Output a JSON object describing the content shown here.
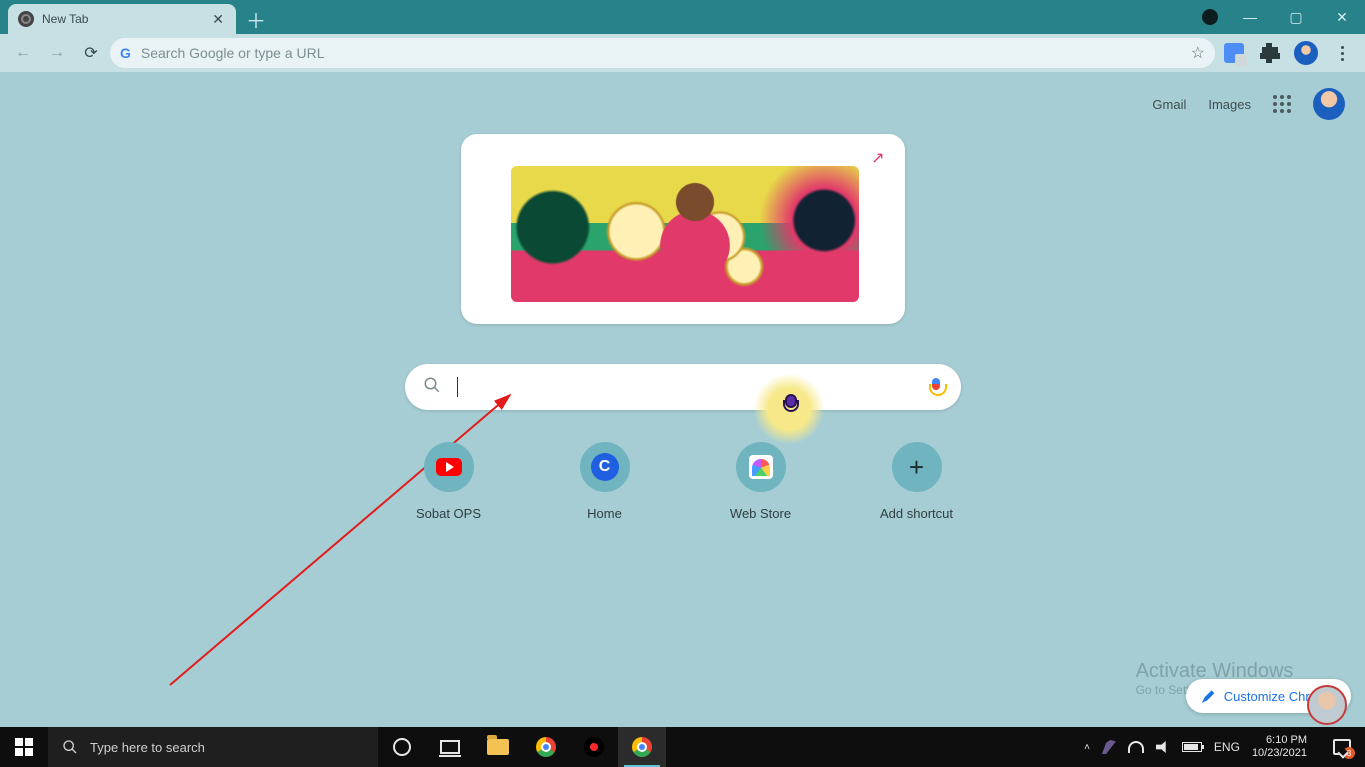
{
  "window": {
    "tab_title": "New Tab",
    "close_glyph": "✕",
    "newtab_glyph": "＋",
    "minimize_glyph": "—",
    "maximize_glyph": "▢",
    "winclose_glyph": "✕"
  },
  "toolbar": {
    "back_glyph": "←",
    "forward_glyph": "→",
    "reload_glyph": "⟳",
    "g_label": "G",
    "omnibox_placeholder": "Search Google or type a URL",
    "star_glyph": "☆"
  },
  "ntp": {
    "links": {
      "gmail": "Gmail",
      "images": "Images"
    },
    "share_glyph": "↗",
    "shortcuts": [
      {
        "label": "Sobat OPS"
      },
      {
        "label": "Home",
        "letter": "C"
      },
      {
        "label": "Web Store"
      },
      {
        "label": "Add shortcut",
        "plus": "+"
      }
    ],
    "customize_label": "Customize Chrome"
  },
  "watermark": {
    "line1": "Activate Windows",
    "line2": "Go to Settings to activate Windows."
  },
  "taskbar": {
    "search_placeholder": "Type here to search",
    "tray": {
      "up_glyph": "˄",
      "lang": "ENG",
      "time": "6:10 PM",
      "date": "10/23/2021",
      "notif_count": "3"
    }
  }
}
